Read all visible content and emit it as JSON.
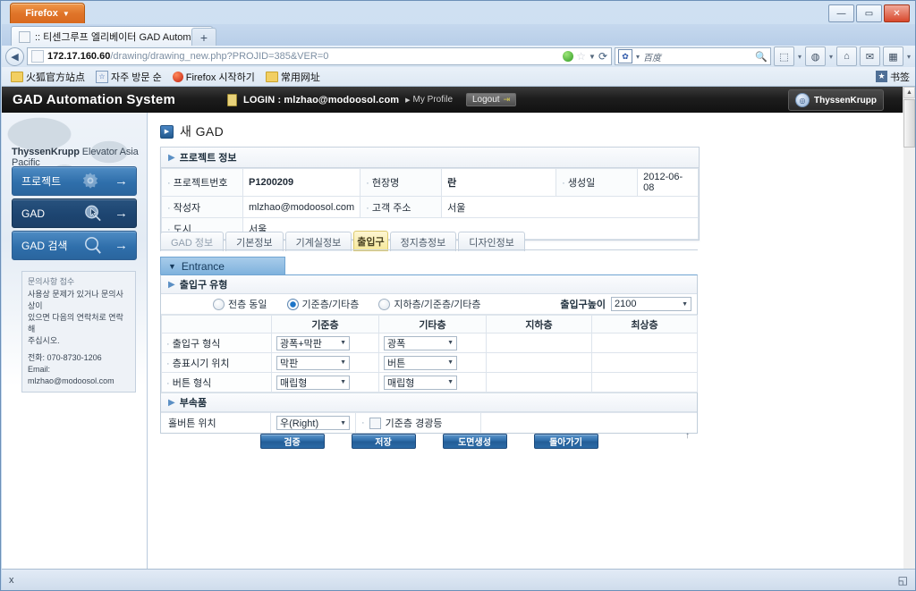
{
  "browser": {
    "app_button": "Firefox",
    "tab_title": ":: 티센그루프 엘리베이터 GAD Automa...",
    "new_tab_label": "+",
    "url_prefix": "172.17.160.60",
    "url_rest": "/drawing/drawing_new.php?PROJID=385&VER=0",
    "search_placeholder": "百度",
    "window_buttons": {
      "minimize": "—",
      "maximize": "▭",
      "close": "✕"
    },
    "bookmarks": [
      {
        "label": "火狐官方站点",
        "icon": "folder-icon"
      },
      {
        "label": "자주 방문 순",
        "icon": "bookmark-icon"
      },
      {
        "label": "Firefox 시작하기",
        "icon": "firefox-icon"
      },
      {
        "label": "常用网址",
        "icon": "folder-icon"
      }
    ],
    "bookmarks_right_label": "书签",
    "find_bar": {
      "close": "x"
    }
  },
  "app": {
    "logo_text": "GAD Automation System",
    "login_label": "LOGIN : mlzhao@modoosol.com",
    "my_profile": "My Profile",
    "logout": "Logout",
    "brand": "ThyssenKrupp"
  },
  "sidebar": {
    "org_name_bold": "ThyssenKrupp",
    "org_name_rest": " Elevator Asia Pacific",
    "nav": [
      {
        "label": "프로젝트",
        "icon": "gear-icon",
        "active": false
      },
      {
        "label": "GAD",
        "icon": "cursor-magnifier-icon",
        "active": true
      },
      {
        "label": "GAD 검색",
        "icon": "magnifier-icon",
        "active": false
      }
    ],
    "contact": {
      "heading": "문의사항 접수",
      "line1": "사용상 문제가 있거나 문의사상이",
      "line2": "있으면 다음의 연락처로 연락해",
      "line3": "주십시오.",
      "phone": "전화: 070-8730-1206",
      "email": "Email: mlzhao@modoosol.com"
    }
  },
  "page": {
    "title": "새  GAD"
  },
  "project_info": {
    "panel_title": "프로젝트 정보",
    "rows": [
      [
        {
          "label": "프로젝트번호",
          "value": "P1200209",
          "bold": true
        },
        {
          "label": "현장명",
          "value": "란",
          "bold": true
        },
        {
          "label": "생성일",
          "value": "2012-06-08",
          "bold": false
        }
      ],
      [
        {
          "label": "작성자",
          "value": "mlzhao@modoosol.com",
          "bold": false
        },
        {
          "label": "고객 주소",
          "value": "서울",
          "bold": false
        }
      ],
      [
        {
          "label": "도시",
          "value": "서울",
          "bold": false
        }
      ]
    ]
  },
  "tabs": [
    {
      "label": "GAD 정보",
      "selected": false,
      "dim": true
    },
    {
      "label": "기본정보",
      "selected": false,
      "dim": false
    },
    {
      "label": "기계실정보",
      "selected": false,
      "dim": false
    },
    {
      "label": "출입구",
      "selected": true,
      "dim": false
    },
    {
      "label": "정지층정보",
      "selected": false,
      "dim": false
    },
    {
      "label": "디자인정보",
      "selected": false,
      "dim": false
    }
  ],
  "entrance": {
    "section_title": "Entrance",
    "collapse_icon": "chevron-down-icon",
    "type_section_title": "출입구 유형",
    "radios": [
      {
        "label": "전층 동일",
        "checked": false
      },
      {
        "label": "기준층/기타층",
        "checked": true
      },
      {
        "label": "지하층/기준층/기타층",
        "checked": false
      }
    ],
    "height_label": "출입구높이",
    "height_value": "2100",
    "columns": [
      "",
      "기준층",
      "기타층",
      "지하층",
      "최상층"
    ],
    "rows": [
      {
        "label": "출입구 형식",
        "std": "광폭+막판",
        "other": "광폭",
        "base": "",
        "top": ""
      },
      {
        "label": "층표시기 위치",
        "std": "막판",
        "other": "버튼",
        "base": "",
        "top": ""
      },
      {
        "label": "버튼 형식",
        "std": "매립형",
        "other": "매립형",
        "base": "",
        "top": ""
      }
    ],
    "accessory_section_title": "부속품",
    "hall_button_label": "홀버튼 위치",
    "hall_button_value": "우(Right)",
    "warn_lamp_label": "기준층 경광등",
    "warn_lamp_checked": false
  },
  "buttons": [
    {
      "label": "검증"
    },
    {
      "label": "저장"
    },
    {
      "label": "도면생성"
    },
    {
      "label": "돌아가기"
    }
  ],
  "colors": {
    "accent_blue": "#2f6fab",
    "tab_selected": "#f6e89a",
    "header_black": "#111111",
    "entrance_header": "#7fb2dd"
  }
}
